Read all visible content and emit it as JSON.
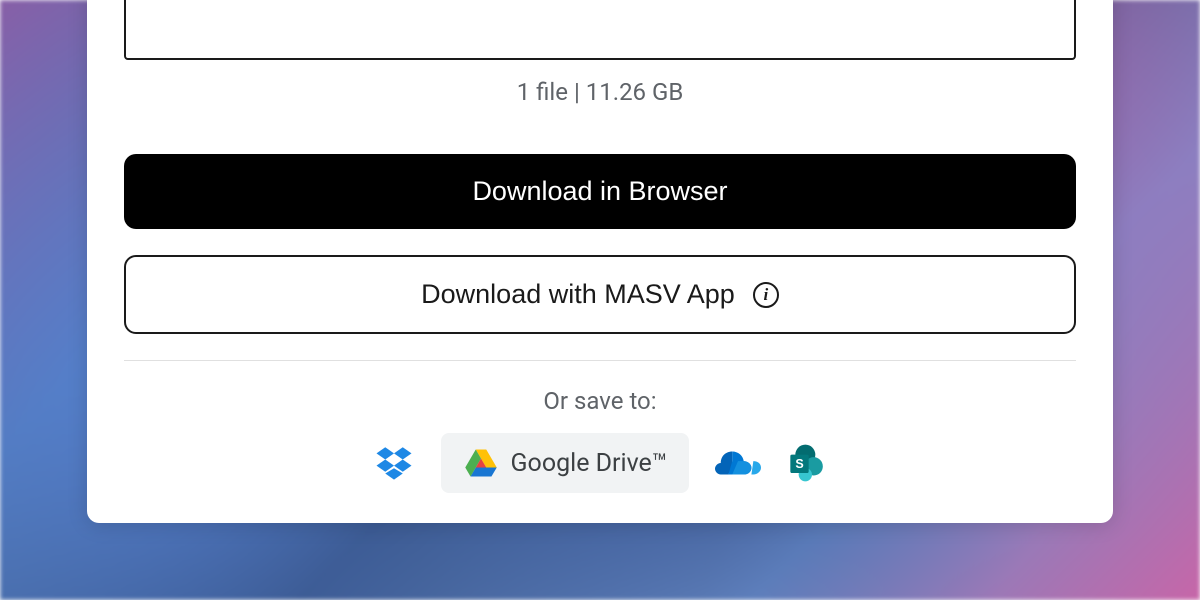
{
  "fileInfo": {
    "summary": "1 file | 11.26 GB"
  },
  "buttons": {
    "downloadBrowser": "Download in Browser",
    "downloadApp": "Download with MASV App"
  },
  "saveTo": {
    "label": "Or save to:",
    "googleDrive": "Google Drive™"
  }
}
